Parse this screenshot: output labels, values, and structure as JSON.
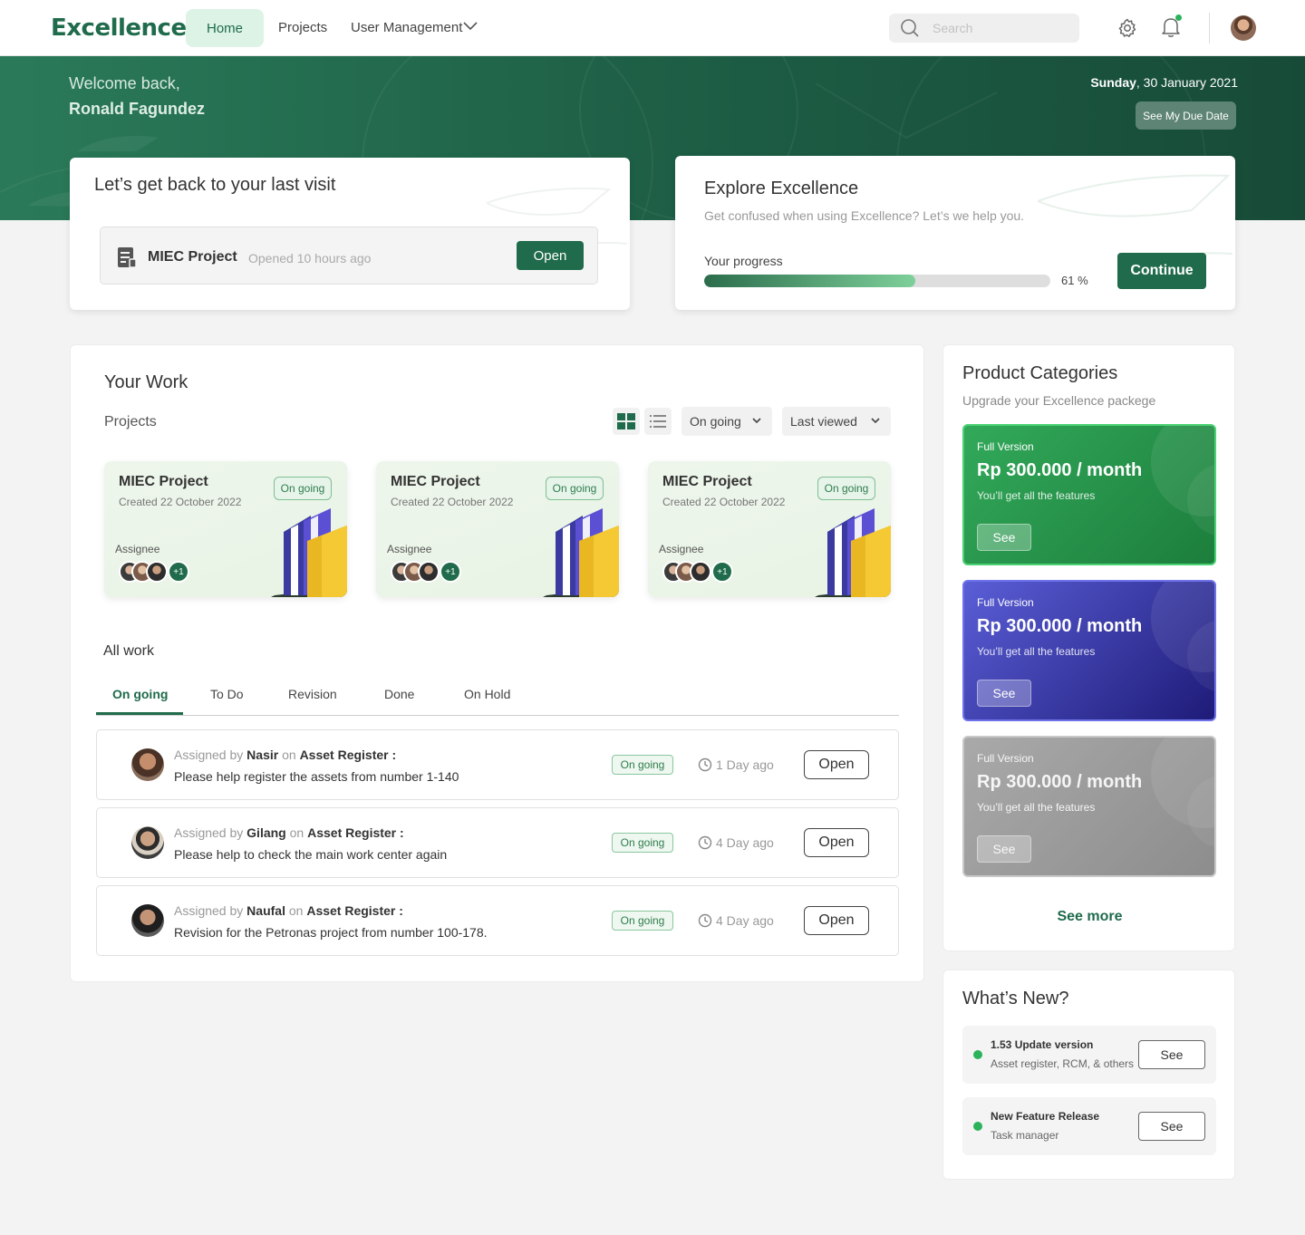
{
  "nav": {
    "logo": "Excellence",
    "home": "Home",
    "projects": "Projects",
    "user_management": "User Management",
    "search_placeholder": "Search"
  },
  "hero": {
    "welcome": "Welcome back,",
    "username": "Ronald Fagundez",
    "date_day": "Sunday",
    "date_rest": ", 30 January 2021",
    "due_date_button": "See My Due Date"
  },
  "last_visit": {
    "title": "Let’s get back to your last visit",
    "project_name": "MIEC Project",
    "opened": "Opened 10 hours ago",
    "open_button": "Open"
  },
  "explore": {
    "title": "Explore Excellence",
    "subtitle": "Get confused when using Excellence? Let’s we help you.",
    "progress_label": "Your progress",
    "progress_value": 0.61,
    "progress_text": "61 %",
    "continue_button": "Continue"
  },
  "your_work": {
    "title": "Your Work",
    "projects_label": "Projects",
    "status_filter": "On going",
    "sort_filter": "Last viewed",
    "project_cards": [
      {
        "name": "MIEC Project",
        "created": "Created 22 October 2022",
        "status": "On going",
        "assignee_label": "Assignee",
        "extra": "+1"
      },
      {
        "name": "MIEC Project",
        "created": "Created 22 October 2022",
        "status": "On going",
        "assignee_label": "Assignee",
        "extra": "+1"
      },
      {
        "name": "MIEC Project",
        "created": "Created 22 October 2022",
        "status": "On going",
        "assignee_label": "Assignee",
        "extra": "+1"
      }
    ],
    "all_work_label": "All work",
    "tabs": [
      "On going",
      "To Do",
      "Revision",
      "Done",
      "On Hold"
    ],
    "work_items": [
      {
        "assigned_by": "Assigned by",
        "name": "Nasir",
        "on": "on",
        "module": "Asset Register :",
        "task": "Please help register the assets from number 1-140",
        "status": "On going",
        "time": "1 Day ago",
        "open": "Open"
      },
      {
        "assigned_by": "Assigned by",
        "name": "Gilang",
        "on": "on",
        "module": "Asset Register :",
        "task": "Please help to check the main work center again",
        "status": "On going",
        "time": "4 Day ago",
        "open": "Open"
      },
      {
        "assigned_by": "Assigned by",
        "name": "Naufal",
        "on": "on",
        "module": "Asset Register :",
        "task": "Revision for the Petronas project from number 100-178.",
        "status": "On going",
        "time": "4 Day ago",
        "open": "Open"
      }
    ]
  },
  "products": {
    "title": "Product  Categories",
    "subtitle": "Upgrade your Excellence packege",
    "plans": [
      {
        "tag": "Full Version",
        "price": "Rp 300.000 / month",
        "desc": "You’ll get all the features",
        "button": "See",
        "color": "#2a9a4f"
      },
      {
        "tag": "Full Version",
        "price": "Rp 300.000 / month",
        "desc": "You’ll get all the features",
        "button": "See",
        "color": "#3b3aa8"
      },
      {
        "tag": "Full Version",
        "price": "Rp 300.000 / month",
        "desc": "You’ll get all the features",
        "button": "See",
        "color": "#9b9b9b"
      }
    ],
    "see_more": "See more"
  },
  "whats_new": {
    "title": "What’s New?",
    "items": [
      {
        "head": "1.53 Update version",
        "sub": "Asset register, RCM, & others",
        "button": "See"
      },
      {
        "head": "New Feature Release",
        "sub": "Task manager",
        "button": "See"
      }
    ]
  },
  "colors": {
    "brand": "#1f6b4b",
    "accent_light": "#dcf3e6",
    "status_green": "#2ab35a"
  }
}
